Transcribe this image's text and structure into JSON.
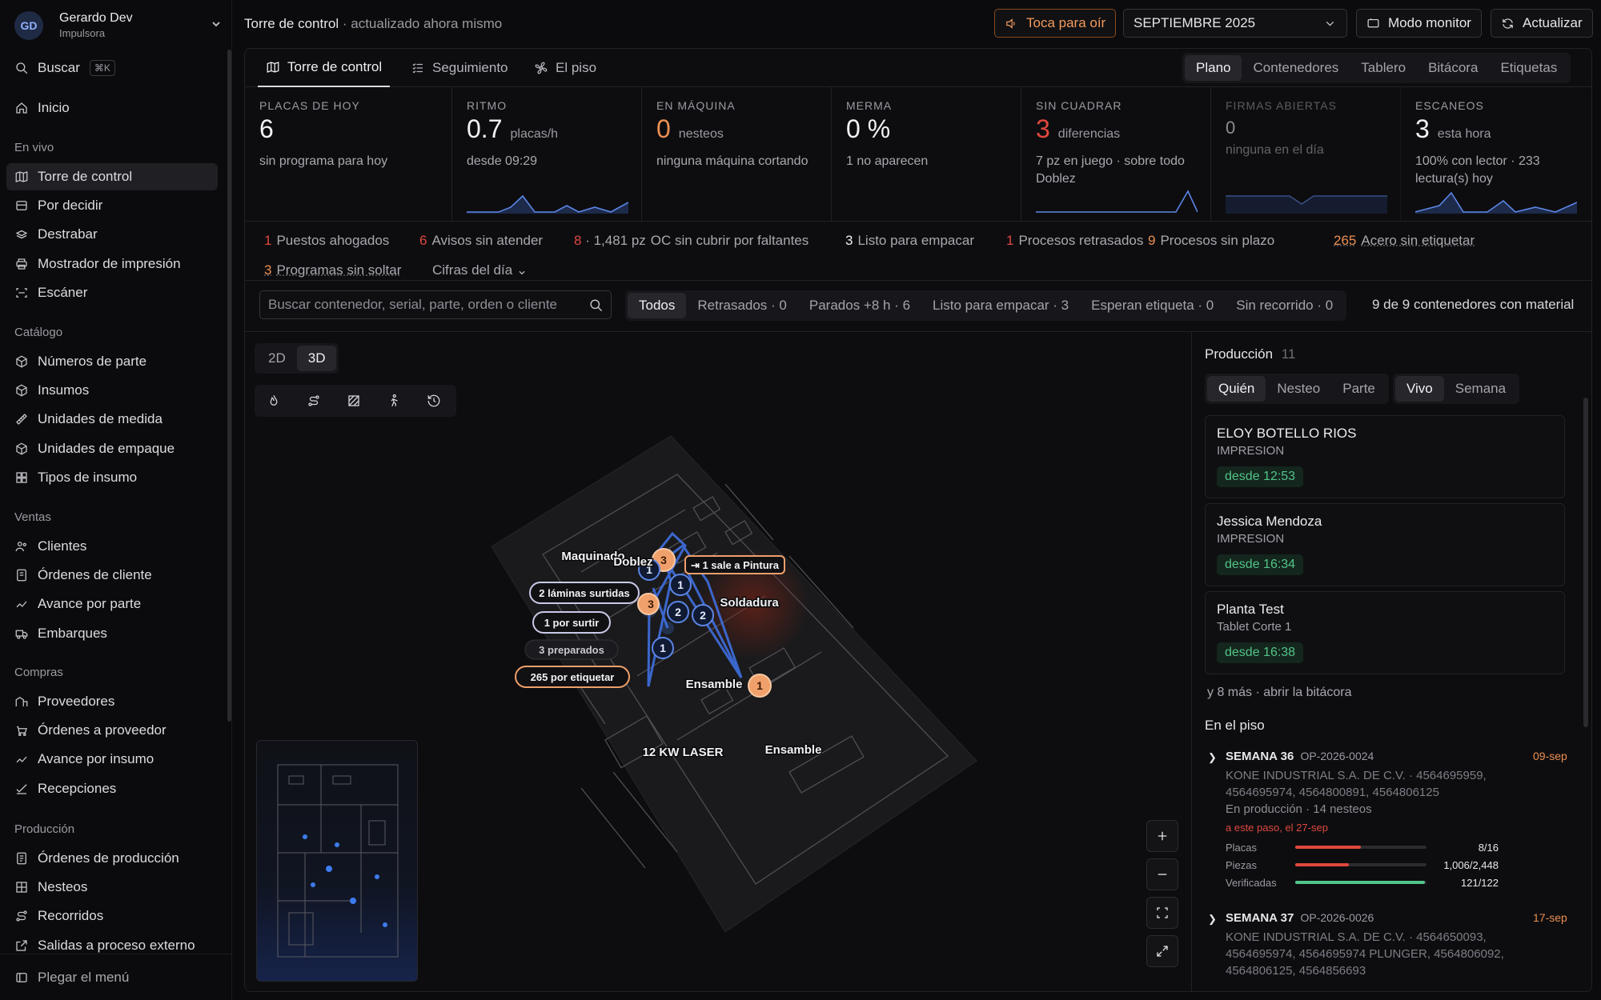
{
  "user": {
    "initials": "GD",
    "name": "Gerardo Dev",
    "role": "Impulsora"
  },
  "sidebar": {
    "search": "Buscar",
    "search_kbd": "⌘K",
    "home": "Inicio",
    "sections": [
      {
        "title": "En vivo",
        "items": [
          "Torre de control",
          "Por decidir",
          "Destrabar",
          "Mostrador de impresión",
          "Escáner"
        ]
      },
      {
        "title": "Catálogo",
        "items": [
          "Números de parte",
          "Insumos",
          "Unidades de medida",
          "Unidades de empaque",
          "Tipos de insumo"
        ]
      },
      {
        "title": "Ventas",
        "items": [
          "Clientes",
          "Órdenes de cliente",
          "Avance por parte",
          "Embarques"
        ]
      },
      {
        "title": "Compras",
        "items": [
          "Proveedores",
          "Órdenes a proveedor",
          "Avance por insumo",
          "Recepciones"
        ]
      },
      {
        "title": "Producción",
        "items": [
          "Órdenes de producción",
          "Nesteos",
          "Recorridos",
          "Salidas a proceso externo"
        ]
      }
    ],
    "collapse": "Plegar el menú"
  },
  "header": {
    "title": "Torre de control",
    "status": "· actualizado ahora mismo",
    "listen": "Toca para oír",
    "month": "SEPTIEMBRE 2025",
    "monitor": "Modo monitor",
    "refresh": "Actualizar"
  },
  "tabs": [
    "Torre de control",
    "Seguimiento",
    "El piso"
  ],
  "views": [
    "Plano",
    "Contenedores",
    "Tablero",
    "Bitácora",
    "Etiquetas"
  ],
  "kpis": [
    {
      "label": "PLACAS DE HOY",
      "value": "6",
      "unit": "",
      "sub": "sin programa para hoy",
      "sub2": ""
    },
    {
      "label": "RITMO",
      "value": "0.7",
      "unit": "placas/h",
      "sub": "desde 09:29",
      "sub2": ""
    },
    {
      "label": "EN MÁQUINA",
      "value": "0",
      "unit": "nesteos",
      "sub": "ninguna máquina cortando",
      "sub2": ""
    },
    {
      "label": "MERMA",
      "value": "0 %",
      "unit": "",
      "sub": "1 no aparecen",
      "sub2": ""
    },
    {
      "label": "SIN CUADRAR",
      "value": "3",
      "unit": "diferencias",
      "sub": "7 pz en juego · sobre todo Doblez",
      "sub2": ""
    },
    {
      "label": "FIRMAS ABIERTAS",
      "value": "0",
      "unit": "",
      "sub": "ninguna en el día",
      "sub2": ""
    },
    {
      "label": "ESCANEOS",
      "value": "3",
      "unit": "esta hora",
      "sub": "100% con lector · 233 lectura(s) hoy",
      "sub2": ""
    }
  ],
  "alerts": [
    {
      "n": "1",
      "t": "Puestos ahogados"
    },
    {
      "n": "6",
      "t": "Avisos sin atender"
    },
    {
      "n": "8 · 1,481 pz",
      "t": "OC sin cubrir por faltantes"
    },
    {
      "n": "3",
      "t": "Listo para empacar"
    },
    {
      "n": "1",
      "t": "Procesos retrasados"
    },
    {
      "n": "9",
      "t": "Procesos sin plazo"
    },
    {
      "n": "265",
      "t": "Acero sin etiquetar"
    },
    {
      "n": "3",
      "t": "Programas sin soltar"
    }
  ],
  "alerts_more": "Cifras del día",
  "filters": {
    "placeholder": "Buscar contenedor, serial, parte, orden o cliente",
    "chips": [
      "Todos",
      "Retrasados · 0",
      "Parados +8 h · 6",
      "Listo para empacar · 3",
      "Esperan etiqueta · 0",
      "Sin recorrido · 0"
    ],
    "summary": "9 de 9 contenedores con material"
  },
  "map": {
    "modes": [
      "2D",
      "3D"
    ],
    "zones": [
      "Maquinado",
      "Doblez",
      "Soldadura",
      "Ensamble",
      "12 KW LASER",
      "Ensamble"
    ],
    "pills": [
      "1 sale a Pintura",
      "2 láminas surtidas",
      "1 por surtir",
      "3 preparados",
      "265 por etiquetar"
    ],
    "nodes": [
      "3",
      "1",
      "1",
      "2",
      "2",
      "1",
      "1"
    ]
  },
  "production": {
    "title": "Producción",
    "count": "11",
    "seg1": [
      "Quién",
      "Nesteo",
      "Parte"
    ],
    "seg2": [
      "Vivo",
      "Semana"
    ],
    "people": [
      {
        "name": "ELOY BOTELLO RIOS",
        "role": "IMPRESION",
        "since": "desde 12:53"
      },
      {
        "name": "Jessica Mendoza",
        "role": "IMPRESION",
        "since": "desde 16:34"
      },
      {
        "name": "Planta Test",
        "role": "Tablet Corte 1",
        "since": "desde 16:38"
      }
    ],
    "more": "y 8 más · abrir la bitácora"
  },
  "floor": {
    "title": "En el piso",
    "weeks": [
      {
        "week": "SEMANA 36",
        "op": "OP-2026-0024",
        "date": "09-sep",
        "client": "KONE INDUSTRIAL S.A. DE C.V. · 4564695959, 4564695974, 4564800891, 4564806125",
        "status": "En producción · 14 nesteos",
        "warn": "a este paso, el 27-sep",
        "bars": [
          {
            "label": "Placas",
            "value": "8/16",
            "frac": 0.5,
            "color": "#e0483d"
          },
          {
            "label": "Piezas",
            "value": "1,006/2,448",
            "frac": 0.41,
            "color": "#e0483d"
          },
          {
            "label": "Verificadas",
            "value": "121/122",
            "frac": 0.99,
            "color": "#52c489"
          }
        ]
      },
      {
        "week": "SEMANA 37",
        "op": "OP-2026-0026",
        "date": "17-sep",
        "client": "KONE INDUSTRIAL S.A. DE C.V. · 4564650093, 4564695974, 4564695974 PLUNGER, 4564806092, 4564806125, 4564856693"
      }
    ]
  }
}
